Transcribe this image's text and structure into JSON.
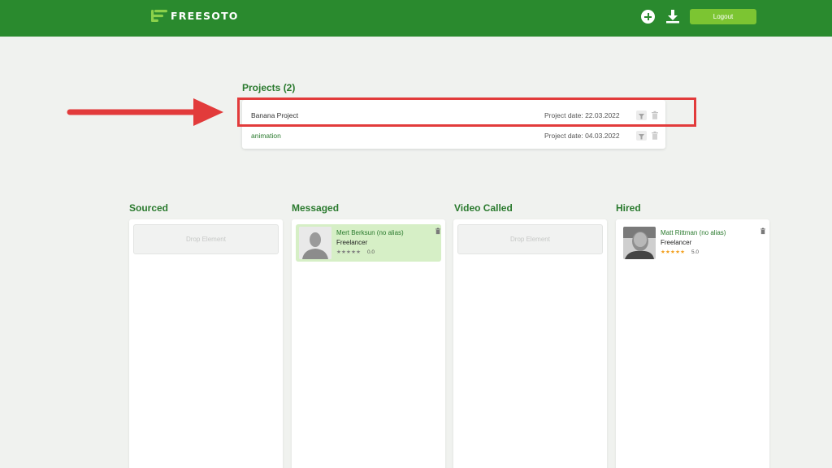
{
  "header": {
    "logo_text": "FREESOTO",
    "add_icon": "plus-circle-icon",
    "download_icon": "download-icon",
    "logout_label": "Logout",
    "bg_color": "#2a8a2e",
    "accent_color": "#7cc532"
  },
  "projects": {
    "title": "Projects (2)",
    "items": [
      {
        "name": "Banana Project",
        "date": "Project date: 22.03.2022"
      },
      {
        "name": "animation",
        "date": "Project date: 04.03.2022"
      }
    ]
  },
  "annotation": {
    "color": "#e23b3b",
    "icon": "arrow-right-icon"
  },
  "board": {
    "columns": [
      {
        "title": "Sourced",
        "drop_label": "Drop Element"
      },
      {
        "title": "Messaged",
        "card": {
          "name": "Mert Berksun (no alias)",
          "role": "Freelancer",
          "stars": "★★★★★",
          "rating": "0.0"
        }
      },
      {
        "title": "Video Called",
        "drop_label": "Drop Element"
      },
      {
        "title": "Hired",
        "card": {
          "name": "Matt Rittman (no alias)",
          "role": "Freelancer",
          "stars": "★★★★★",
          "rating": "5.0"
        }
      }
    ]
  }
}
